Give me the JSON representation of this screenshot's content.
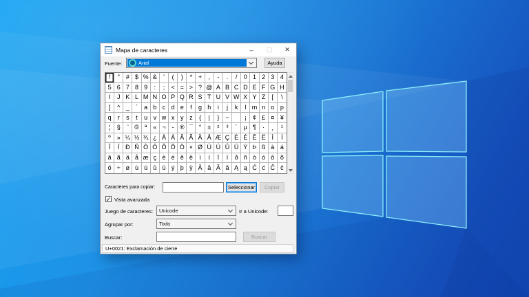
{
  "wallpaper": {
    "base_color": "#1b77d4",
    "logo_stroke": "#8ceef8"
  },
  "icons": {
    "minimize": "–",
    "maximize": "▢",
    "close": "✕",
    "check": "✓"
  },
  "dialog": {
    "title": "Mapa de caracteres",
    "font_row": {
      "label": "Fuente:",
      "value": "Arial",
      "help_button": "Ayuda"
    },
    "grid": {
      "selected": {
        "row": 0,
        "col": 0
      },
      "rows": [
        [
          "!",
          "\"",
          "#",
          "$",
          "%",
          "&",
          "'",
          "(",
          ")",
          "*",
          "+",
          ",",
          "-",
          ".",
          "/",
          "0",
          "1",
          "2",
          "3",
          "4"
        ],
        [
          "5",
          "6",
          "7",
          "8",
          "9",
          ":",
          ";",
          "<",
          "=",
          ">",
          "?",
          "@",
          "A",
          "B",
          "C",
          "D",
          "E",
          "F",
          "G",
          "H"
        ],
        [
          "I",
          "J",
          "K",
          "L",
          "M",
          "N",
          "O",
          "P",
          "Q",
          "R",
          "S",
          "T",
          "U",
          "V",
          "W",
          "X",
          "Y",
          "Z",
          "[",
          "\\"
        ],
        [
          "]",
          "^",
          "_",
          "`",
          "a",
          "b",
          "c",
          "d",
          "e",
          "f",
          "g",
          "h",
          "i",
          "j",
          "k",
          "l",
          "m",
          "n",
          "o",
          "p"
        ],
        [
          "q",
          "r",
          "s",
          "t",
          "u",
          "v",
          "w",
          "x",
          "y",
          "z",
          "{",
          "|",
          "}",
          "~",
          "",
          "¡",
          "¢",
          "£",
          "¤",
          "¥"
        ],
        [
          "¦",
          "§",
          "¨",
          "©",
          "ª",
          "«",
          "¬",
          "-",
          "®",
          "¯",
          "°",
          "±",
          "²",
          "³",
          "´",
          "µ",
          "¶",
          "·",
          "¸",
          "¹"
        ],
        [
          "º",
          "»",
          "¼",
          "½",
          "¾",
          "¿",
          "À",
          "Á",
          "Â",
          "Ã",
          "Ä",
          "Å",
          "Æ",
          "Ç",
          "È",
          "É",
          "Ê",
          "Ë",
          "Ì",
          "Í"
        ],
        [
          "Î",
          "Ï",
          "Ð",
          "Ñ",
          "Ò",
          "Ó",
          "Ô",
          "Õ",
          "Ö",
          "×",
          "Ø",
          "Ù",
          "Ú",
          "Û",
          "Ü",
          "Ý",
          "Þ",
          "ß",
          "à",
          "á"
        ],
        [
          "â",
          "ã",
          "ä",
          "å",
          "æ",
          "ç",
          "è",
          "é",
          "ê",
          "ë",
          "ì",
          "í",
          "î",
          "ï",
          "ð",
          "ñ",
          "ò",
          "ó",
          "ô",
          "õ"
        ],
        [
          "ö",
          "÷",
          "ø",
          "ù",
          "ú",
          "û",
          "ü",
          "ý",
          "þ",
          "ÿ",
          "Ā",
          "ā",
          "Ă",
          "ă",
          "Ą",
          "ą",
          "Ć",
          "ć",
          "Ĉ",
          "ĉ"
        ]
      ]
    },
    "copy_row": {
      "label": "Caracteres para copiar:",
      "value": "",
      "select_button": "Seleccionar",
      "copy_button": "Copiar"
    },
    "advanced_view": {
      "label": "Vista avanzada",
      "checked": true
    },
    "charset_row": {
      "label": "Juego de caracteres:",
      "value": "Unicode",
      "goto_label": "Ir a Unicode:",
      "goto_value": ""
    },
    "group_row": {
      "label": "Agrupar por:",
      "value": "Todo"
    },
    "search_row": {
      "label": "Buscar:",
      "value": "",
      "button": "Buscar"
    },
    "status": "U+0021: Exclamación de cierre"
  }
}
